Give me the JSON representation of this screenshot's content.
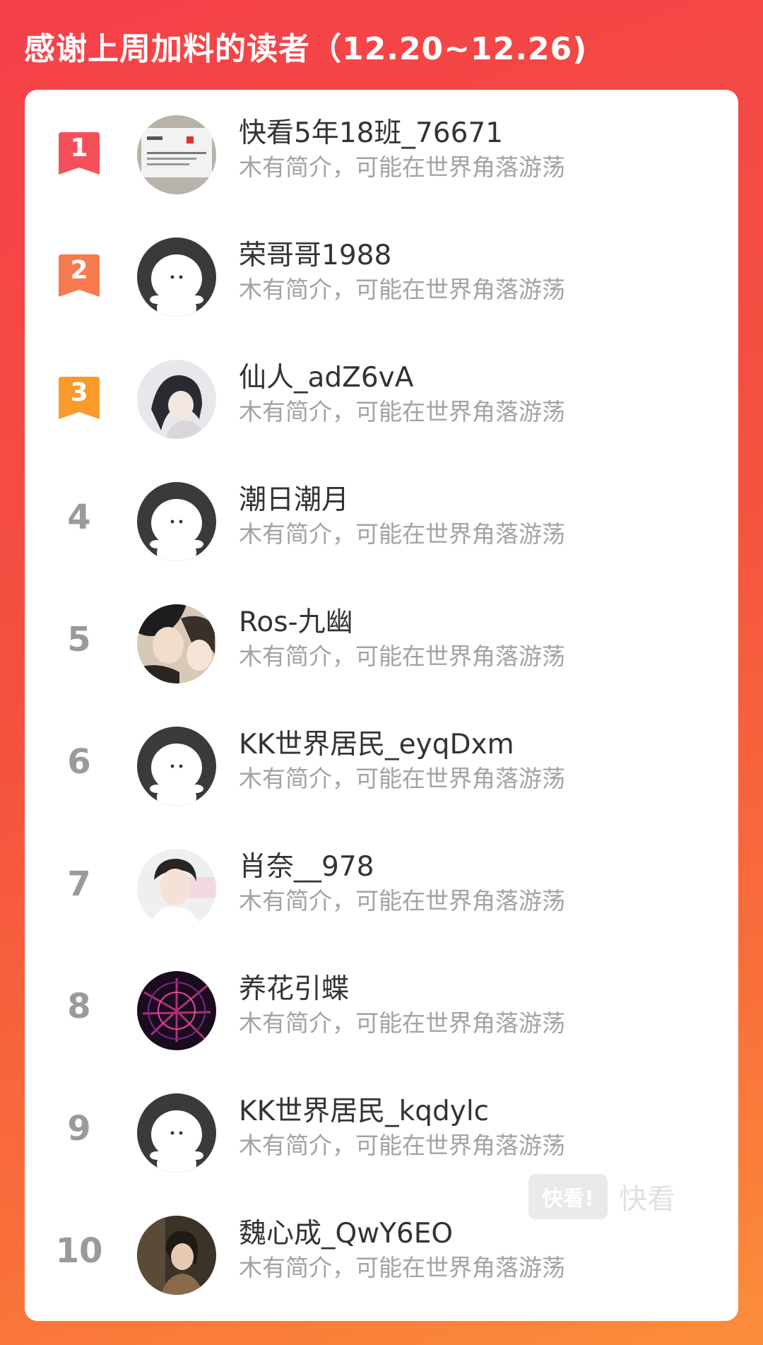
{
  "header": {
    "title": "感谢上周加料的读者（12.20~12.26)"
  },
  "colors": {
    "background_top": "#f5414a",
    "background_bottom": "#fb8e3a",
    "rank1": "#f5505a",
    "rank2": "#f77a4e",
    "rank3": "#f99a2a",
    "rank_gray": "#9a9a9a",
    "name": "#333333",
    "bio": "#a3a3a3"
  },
  "readers": [
    {
      "rank": "1",
      "name": "快看5年18班_76671",
      "bio": "木有简介，可能在世界角落游荡",
      "avatar": "photo-card-avatar"
    },
    {
      "rank": "2",
      "name": "荣哥哥1988",
      "bio": "木有简介，可能在世界角落游荡",
      "avatar": "default-avatar"
    },
    {
      "rank": "3",
      "name": "仙人_adZ6vA",
      "bio": "木有简介，可能在世界角落游荡",
      "avatar": "anime-avatar"
    },
    {
      "rank": "4",
      "name": "潮日潮月",
      "bio": "木有简介，可能在世界角落游荡",
      "avatar": "default-avatar"
    },
    {
      "rank": "5",
      "name": "Ros-九幽",
      "bio": "木有简介，可能在世界角落游荡",
      "avatar": "comic-avatar"
    },
    {
      "rank": "6",
      "name": "KK世界居民_eyqDxm",
      "bio": "木有简介，可能在世界角落游荡",
      "avatar": "default-avatar"
    },
    {
      "rank": "7",
      "name": "肖奈__978",
      "bio": "木有简介，可能在世界角落游荡",
      "avatar": "portrait-avatar"
    },
    {
      "rank": "8",
      "name": "养花引蝶",
      "bio": "木有简介，可能在世界角落游荡",
      "avatar": "purple-abstract-avatar"
    },
    {
      "rank": "9",
      "name": "KK世界居民_kqdylc",
      "bio": "木有简介，可能在世界角落游荡",
      "avatar": "default-avatar"
    },
    {
      "rank": "10",
      "name": "魏心成_QwY6EO",
      "bio": "木有简介，可能在世界角落游荡",
      "avatar": "photo-avatar"
    }
  ],
  "watermark": {
    "logo_text": "快看!",
    "text": "快看"
  }
}
